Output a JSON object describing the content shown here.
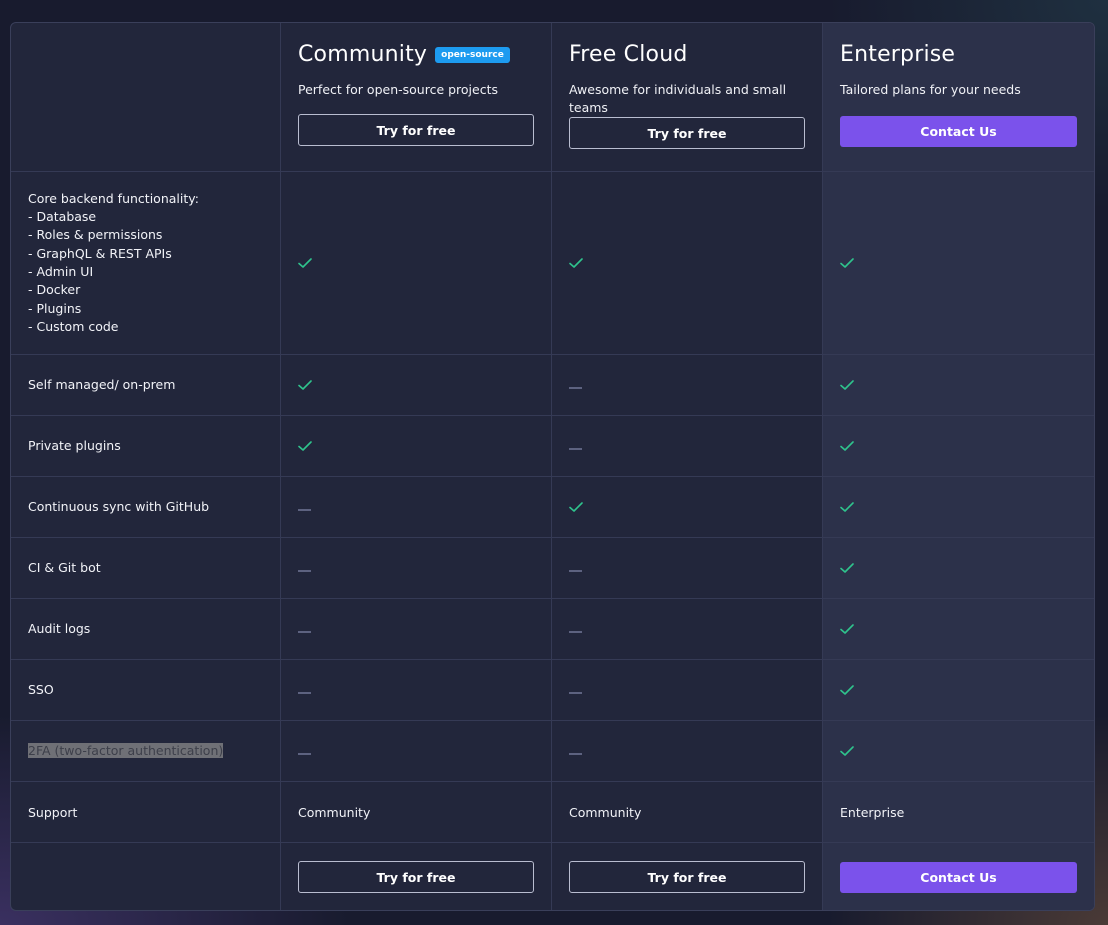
{
  "colors": {
    "check": "#2fc48d",
    "dash": "#5d6280",
    "primary_button": "#7b52eb",
    "badge": "#1d9bf0"
  },
  "plans": [
    {
      "title": "Community",
      "badge": "open-source",
      "description": "Perfect for open-source projects",
      "cta": "Try for free",
      "cta_style": "outline"
    },
    {
      "title": "Free Cloud",
      "badge": null,
      "description": "Awesome for individuals and small teams",
      "cta": "Try for free",
      "cta_style": "outline"
    },
    {
      "title": "Enterprise",
      "badge": null,
      "description": "Tailored plans for your needs",
      "cta": "Contact Us",
      "cta_style": "primary"
    }
  ],
  "features": [
    {
      "label": "Core backend functionality:\n- Database\n- Roles & permissions\n- GraphQL & REST APIs\n- Admin UI\n- Docker\n- Plugins\n- Custom code",
      "values": [
        "check",
        "check",
        "check"
      ]
    },
    {
      "label": "Self managed/ on-prem",
      "values": [
        "check",
        "dash",
        "check"
      ]
    },
    {
      "label": "Private plugins",
      "values": [
        "check",
        "dash",
        "check"
      ]
    },
    {
      "label": "Continuous sync with GitHub",
      "values": [
        "dash",
        "check",
        "check"
      ]
    },
    {
      "label": "CI & Git bot",
      "values": [
        "dash",
        "dash",
        "check"
      ]
    },
    {
      "label": "Audit logs",
      "values": [
        "dash",
        "dash",
        "check"
      ]
    },
    {
      "label": "SSO",
      "values": [
        "dash",
        "dash",
        "check"
      ]
    },
    {
      "label": "2FA (two-factor authentication)",
      "values": [
        "dash",
        "dash",
        "check"
      ],
      "selected": true
    }
  ],
  "support": {
    "label": "Support",
    "values": [
      "Community",
      "Community",
      "Enterprise"
    ]
  },
  "footer": {
    "ctas": [
      "Try for free",
      "Try for free",
      "Contact Us"
    ]
  }
}
